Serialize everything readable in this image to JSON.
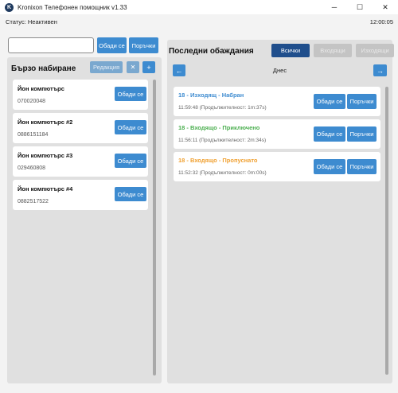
{
  "window": {
    "title": "Kronixon Телефонен помощник v1.33",
    "icon_letter": "K",
    "minimize": "─",
    "maximize": "☐",
    "close": "✕"
  },
  "status": {
    "label": "Статус: Неактивен",
    "time": "12:00:05"
  },
  "search": {
    "value": "",
    "placeholder": "",
    "call_label": "Обади се",
    "orders_label": "Поръчки"
  },
  "speed_dial": {
    "title": "Бързо набиране",
    "edit_label": "Редакция",
    "remove_label": "✕",
    "add_label": "+",
    "call_label": "Обади се",
    "contacts": [
      {
        "name": "Йон компютърс",
        "phone": "070020048"
      },
      {
        "name": "Йон компютърс #2",
        "phone": "0886151184"
      },
      {
        "name": "Йон компютърс #3",
        "phone": "029460808"
      },
      {
        "name": "Йон компютърс #4",
        "phone": "0882517522"
      }
    ]
  },
  "recent": {
    "title": "Последни обаждания",
    "tabs": [
      "Всички",
      "Входящи",
      "Изходящи"
    ],
    "active_tab": "Всички",
    "day_label": "Днес",
    "prev": "←",
    "next": "→",
    "call_label": "Обади се",
    "orders_label": "Поръчки",
    "calls": [
      {
        "title": "18 - Изходящ - Набран",
        "meta": "11:59:48 (Продължителност: 1m:37s)",
        "color": "#3d8bd0"
      },
      {
        "title": "18 - Входящо - Приключено",
        "meta": "11:56:11 (Продължителност: 2m:34s)",
        "color": "#4caf50"
      },
      {
        "title": "18 - Входящо - Пропуснато",
        "meta": "11:52:32 (Продължителност: 0m:00s)",
        "color": "#f0a030"
      }
    ]
  },
  "colors": {
    "primary": "#3d8bd0",
    "active_tab": "#1f4e8c",
    "disabled": "#c4c4c4",
    "panel": "#e0e0e0"
  }
}
